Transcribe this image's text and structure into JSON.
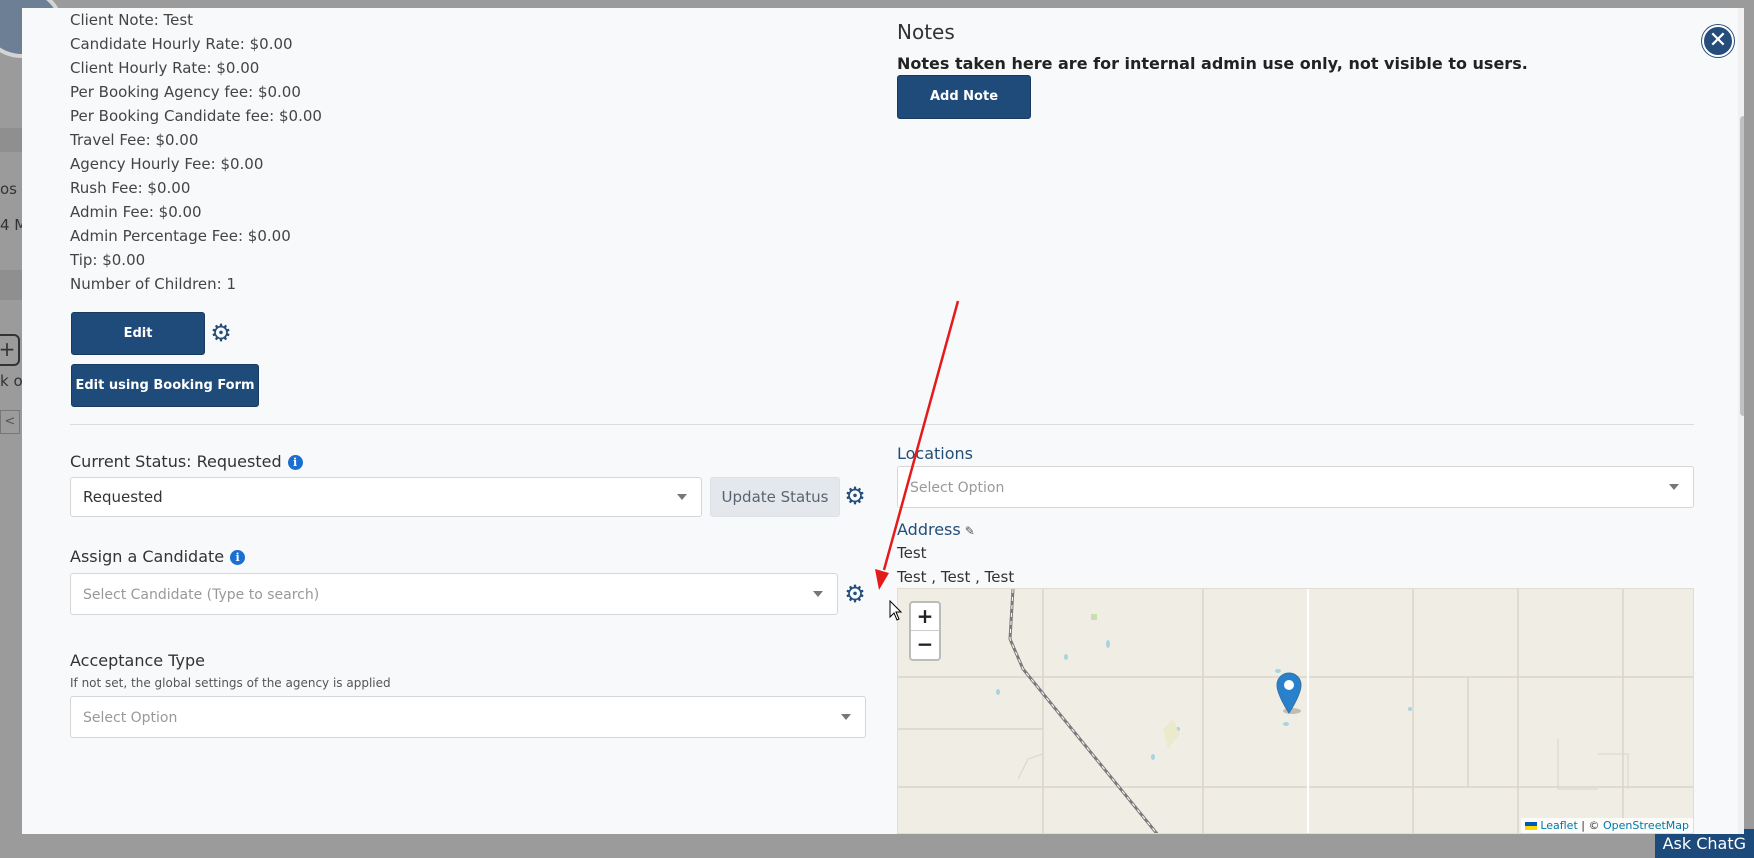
{
  "background": {
    "fragments": [
      "os S",
      "4 M",
      "k o"
    ],
    "ask_chat": "Ask ChatG"
  },
  "booking_details": [
    "Client Note: Test",
    "Candidate Hourly Rate: $0.00",
    "Client Hourly Rate: $0.00",
    "Per Booking Agency fee: $0.00",
    "Per Booking Candidate fee: $0.00",
    "Travel Fee: $0.00",
    "Agency Hourly Fee: $0.00",
    "Rush Fee: $0.00",
    "Admin Fee: $0.00",
    "Admin Percentage Fee: $0.00",
    "Tip: $0.00",
    "Number of Children: 1"
  ],
  "actions": {
    "edit_label": "Edit",
    "edit_booking_form_label": "Edit using Booking Form"
  },
  "notes": {
    "title": "Notes",
    "subtitle": "Notes taken here are for internal admin use only, not visible to users.",
    "add_note_label": "Add Note"
  },
  "status": {
    "label": "Current Status: Requested",
    "selected": "Requested",
    "update_label": "Update Status"
  },
  "candidate": {
    "label": "Assign a Candidate",
    "placeholder": "Select Candidate (Type to search)"
  },
  "acceptance": {
    "label": "Acceptance Type",
    "note": "If not set, the global settings of the agency is applied",
    "placeholder": "Select Option"
  },
  "locations": {
    "label": "Locations",
    "placeholder": "Select Option"
  },
  "address": {
    "label": "Address",
    "line1": "Test",
    "line2": "Test , Test , Test"
  },
  "map": {
    "zoom_in": "+",
    "zoom_out": "−",
    "attribution_leaflet": "Leaflet",
    "attribution_sep": " | © ",
    "attribution_osm": "OpenStreetMap"
  },
  "icons": {
    "close": "close-icon",
    "gear": "gear-icon",
    "info": "info-icon",
    "pencil": "pencil-icon",
    "marker": "map-marker-icon"
  },
  "colors": {
    "primary": "#1f4b7a",
    "info_blue": "#1a6fd1",
    "annotation_arrow": "#e41b1b",
    "marker": "#2a81cb"
  }
}
